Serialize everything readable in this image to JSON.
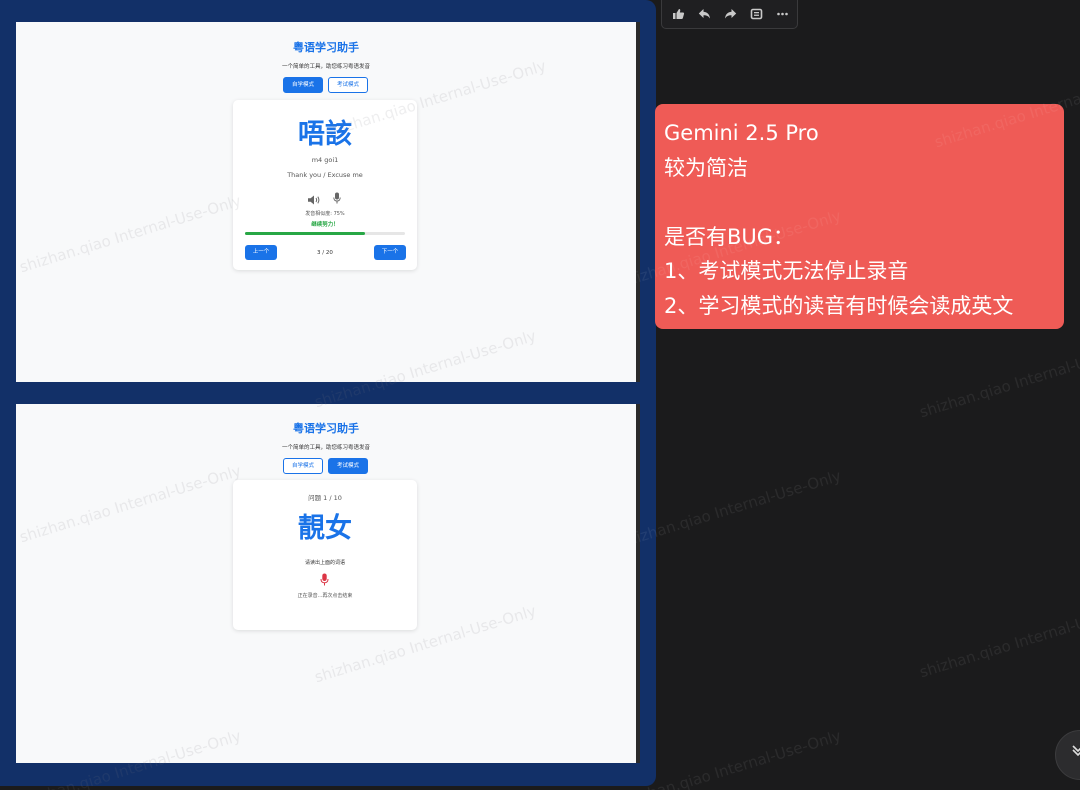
{
  "toolbar": {
    "icons": [
      "thumbs-up-icon",
      "reply-icon",
      "forward-icon",
      "quote-icon",
      "more-icon"
    ]
  },
  "screens": [
    {
      "app_title": "粤语学习助手",
      "subtitle": "一个简单的工具，助您练习粤语发音",
      "mode_buttons": [
        {
          "label": "自学模式",
          "active": true
        },
        {
          "label": "考试模式",
          "active": false
        }
      ],
      "card": {
        "word": "唔該",
        "jyutping": "m4 goi1",
        "translation": "Thank you / Excuse me",
        "similarity": "发音相似度: 75%",
        "feedback": "继续努力！",
        "progress": 0.75,
        "prev_label": "上一个",
        "next_label": "下一个",
        "counter": "3 / 20"
      }
    },
    {
      "app_title": "粤语学习助手",
      "subtitle": "一个简单的工具，助您练习粤语发音",
      "mode_buttons": [
        {
          "label": "自学模式",
          "active": false
        },
        {
          "label": "考试模式",
          "active": true
        }
      ],
      "card": {
        "question": "问题 1 / 10",
        "word": "靚女",
        "instruction": "请读出上面的词语",
        "status": "正在录音...再次点击结束"
      }
    }
  ],
  "note": {
    "lines": [
      "Gemini 2.5 Pro",
      "较为简洁",
      "",
      "是否有BUG：",
      "1、考试模式无法停止录音",
      "2、学习模式的读音有时候会读成英文"
    ]
  },
  "watermark_text": "shizhan.qiao Internal-Use-Only",
  "colors": {
    "accent": "#1a73e8",
    "success": "#28a745",
    "note_bg": "#ef5b56",
    "card_bg": "#123068"
  }
}
